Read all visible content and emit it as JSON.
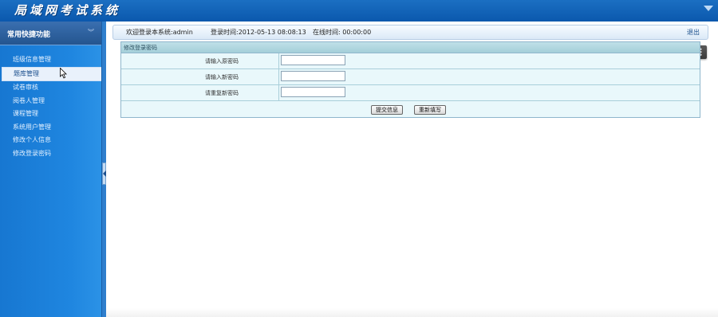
{
  "app": {
    "title": "局域网考试系统"
  },
  "sidebar": {
    "title": "常用快捷功能",
    "items": [
      {
        "label": "班级信息管理",
        "active": false
      },
      {
        "label": "题库管理",
        "active": true
      },
      {
        "label": "试卷审核",
        "active": false
      },
      {
        "label": "阅卷人管理",
        "active": false
      },
      {
        "label": "课程管理",
        "active": false
      },
      {
        "label": "系统用户管理",
        "active": false
      },
      {
        "label": "修改个人信息",
        "active": false
      },
      {
        "label": "修改登录密码",
        "active": false
      }
    ]
  },
  "status": {
    "welcome": "欢迎登录本系统:admin",
    "login_time": "登录时间:2012-05-13 08:08:13",
    "online_time": "在线时间: 00:00:00",
    "logout": "退出"
  },
  "form": {
    "title": "修改登录密码",
    "fields": [
      {
        "label": "请输入原密码",
        "value": ""
      },
      {
        "label": "请输入新密码",
        "value": ""
      },
      {
        "label": "请重复新密码",
        "value": ""
      }
    ],
    "submit_label": "提交信息",
    "reset_label": "重新填写"
  },
  "icons": {
    "collapse": "double-chevron-down-icon",
    "splitter": "chevron-left-icon",
    "ime": "sogou-ime-icon"
  },
  "colors": {
    "top_bar": "#0b58ad",
    "sidebar": "#1f86e0",
    "panel_header": "#a4cfd9",
    "panel_body": "#e9f8fb"
  }
}
